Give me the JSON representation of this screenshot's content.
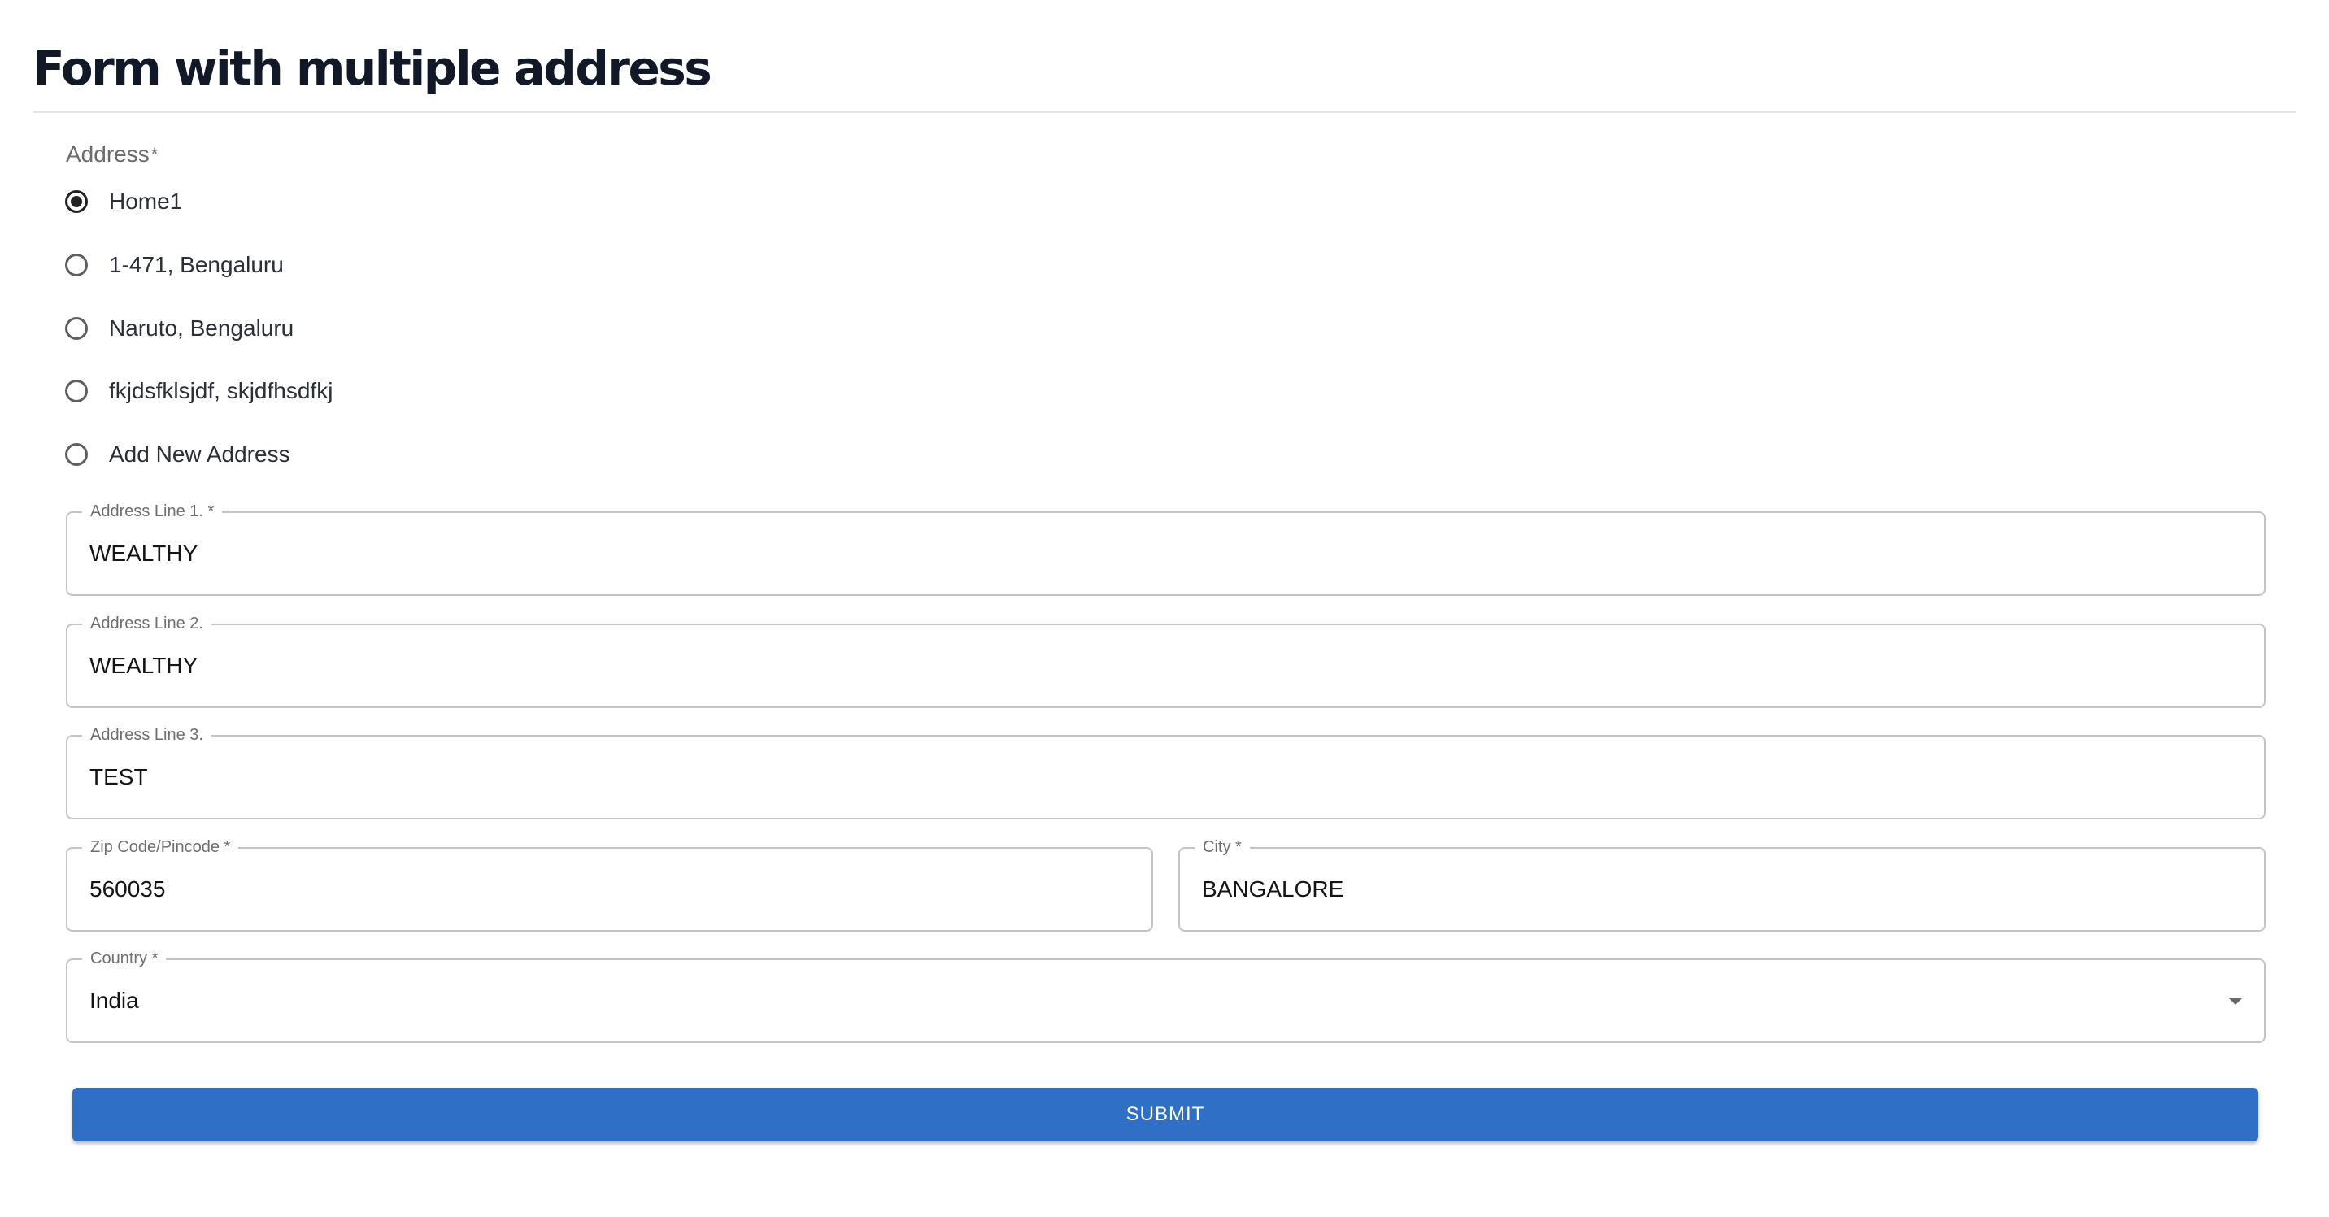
{
  "page": {
    "title": "Form with multiple address"
  },
  "address_group": {
    "label": "Address",
    "required_mark": "*",
    "selected_index": 0,
    "options": [
      {
        "label": "Home1",
        "checked": true
      },
      {
        "label": "1-471, Bengaluru",
        "checked": false
      },
      {
        "label": "Naruto, Bengaluru",
        "checked": false
      },
      {
        "label": "fkjdsfklsjdf, skjdfhsdfkj",
        "checked": false
      },
      {
        "label": "Add New Address",
        "checked": false
      }
    ]
  },
  "fields": {
    "address_line_1": {
      "label": "Address Line 1. *",
      "value": "WEALTHY"
    },
    "address_line_2": {
      "label": "Address Line 2.",
      "value": "WEALTHY"
    },
    "address_line_3": {
      "label": "Address Line 3.",
      "value": "TEST"
    },
    "zip_code": {
      "label": "Zip Code/Pincode *",
      "value": "560035"
    },
    "city": {
      "label": "City *",
      "value": "BANGALORE"
    },
    "country": {
      "label": "Country *",
      "value": "India"
    }
  },
  "submit": {
    "label": "SUBMIT"
  },
  "colors": {
    "primary_button": "#2f6fc6",
    "field_border": "#c4c4c4",
    "title_text": "#111827"
  }
}
